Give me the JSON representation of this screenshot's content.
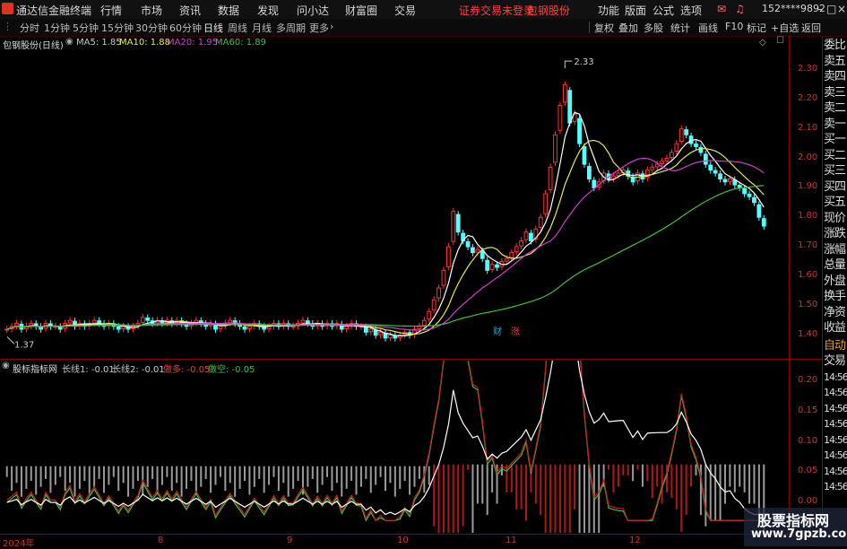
{
  "titlebar": {
    "app_name": "通达信金融终端",
    "menu": [
      "行情",
      "市场",
      "资讯",
      "数据",
      "发现",
      "问小达",
      "财富圈",
      "交易"
    ],
    "login_warning": "证券交易未登录",
    "stock_name": "包钢股份",
    "right_menu": [
      "功能",
      "版面",
      "公式",
      "选项"
    ],
    "account": "152****9892"
  },
  "toolbar": {
    "periods": [
      "分时",
      "1分钟",
      "5分钟",
      "15分钟",
      "30分钟",
      "60分钟",
      "日线",
      "周线",
      "月线",
      "多周期",
      "更多"
    ],
    "active_period": "日线",
    "right_buttons": [
      "复权",
      "叠加",
      "多股",
      "统计",
      "画线",
      "F10",
      "+自选",
      "返回"
    ]
  },
  "main_chart": {
    "stock_label": "包钢股份(日线)",
    "ma_labels": [
      {
        "text": "MA5: 1.85",
        "color": "#ffffff"
      },
      {
        "text": "MA10: 1.88",
        "color": "#e8e85a"
      },
      {
        "text": "MA20: 1.95",
        "color": "#d040d0"
      },
      {
        "text": "MA60: 1.89",
        "color": "#40c040"
      }
    ],
    "high_label": "2.33",
    "low_label": "1.37",
    "badges": [
      {
        "text": "财",
        "color": "#2aa8d8"
      },
      {
        "text": "涨",
        "color": "#e04040"
      }
    ]
  },
  "indicator": {
    "title": "股标指标网",
    "labels": [
      {
        "text": "长线1: -0.01",
        "color": "#dddddd"
      },
      {
        "text": "长线2: -0.01",
        "color": "#dddddd"
      },
      {
        "text": "做多: -0.05",
        "color": "#e04040"
      },
      {
        "text": "做空: -0.05",
        "color": "#40c040"
      }
    ]
  },
  "side_panel": [
    "委比",
    "卖五",
    "卖四",
    "卖三",
    "卖二",
    "卖一",
    "买一",
    "买二",
    "买三",
    "买四",
    "买五",
    "现价",
    "涨跌",
    "涨幅",
    "总量",
    "外盘",
    "换手",
    "净资",
    "收益",
    "自动",
    "交易",
    "14:56",
    "14:56",
    "14:56",
    "14:56",
    "14:56",
    "14:56",
    "14:56",
    "14:56"
  ],
  "x_axis": [
    "2024年",
    "8",
    "9",
    "10",
    "11",
    "12"
  ],
  "watermark": {
    "line1": "股票指标网",
    "line2": "www.7gpzb.com"
  },
  "chart_data": [
    {
      "type": "candlestick",
      "title": "包钢股份(日线)",
      "y_ticks": [
        2.3,
        2.2,
        2.1,
        2.0,
        1.9,
        1.8,
        1.7,
        1.6,
        1.5,
        1.4
      ],
      "ylim": [
        1.35,
        2.37
      ],
      "close": [
        1.42,
        1.43,
        1.44,
        1.42,
        1.43,
        1.44,
        1.43,
        1.42,
        1.44,
        1.43,
        1.43,
        1.42,
        1.44,
        1.45,
        1.43,
        1.44,
        1.43,
        1.44,
        1.45,
        1.44,
        1.43,
        1.44,
        1.43,
        1.42,
        1.43,
        1.42,
        1.43,
        1.44,
        1.46,
        1.45,
        1.44,
        1.45,
        1.44,
        1.45,
        1.44,
        1.45,
        1.44,
        1.43,
        1.44,
        1.45,
        1.44,
        1.43,
        1.44,
        1.42,
        1.43,
        1.44,
        1.45,
        1.44,
        1.43,
        1.42,
        1.43,
        1.44,
        1.43,
        1.42,
        1.43,
        1.44,
        1.43,
        1.44,
        1.43,
        1.43,
        1.44,
        1.45,
        1.44,
        1.43,
        1.44,
        1.43,
        1.44,
        1.43,
        1.44,
        1.42,
        1.43,
        1.44,
        1.43,
        1.43,
        1.41,
        1.42,
        1.4,
        1.41,
        1.39,
        1.4,
        1.39,
        1.4,
        1.41,
        1.4,
        1.42,
        1.43,
        1.45,
        1.48,
        1.52,
        1.56,
        1.62,
        1.7,
        1.82,
        1.75,
        1.72,
        1.7,
        1.68,
        1.69,
        1.66,
        1.62,
        1.64,
        1.63,
        1.65,
        1.66,
        1.68,
        1.7,
        1.72,
        1.75,
        1.72,
        1.76,
        1.8,
        1.88,
        1.97,
        2.08,
        2.18,
        2.25,
        2.12,
        2.15,
        2.05,
        1.98,
        1.93,
        1.9,
        1.92,
        1.95,
        1.93,
        1.94,
        1.95,
        1.96,
        1.94,
        1.92,
        1.95,
        1.93,
        1.96,
        1.97,
        1.98,
        1.99,
        2.0,
        2.02,
        2.05,
        2.1,
        2.08,
        2.05,
        2.04,
        2.02,
        1.98,
        1.96,
        1.95,
        1.93,
        1.92,
        1.93,
        1.91,
        1.9,
        1.88,
        1.87,
        1.85,
        1.8,
        1.77
      ],
      "ma_series": [
        {
          "name": "MA5",
          "color": "#ffffff"
        },
        {
          "name": "MA10",
          "color": "#e8e85a"
        },
        {
          "name": "MA20",
          "color": "#d040d0"
        },
        {
          "name": "MA60",
          "color": "#40c040"
        }
      ]
    },
    {
      "type": "line+bar",
      "title": "股标指标网",
      "y_ticks": [
        0.2,
        0.15,
        0.1,
        0.05,
        0.0
      ],
      "ylim": [
        -0.04,
        0.22
      ]
    }
  ],
  "colors": {
    "up": "#ff3232",
    "down": "#54ffff",
    "accent": "#8b0000"
  }
}
